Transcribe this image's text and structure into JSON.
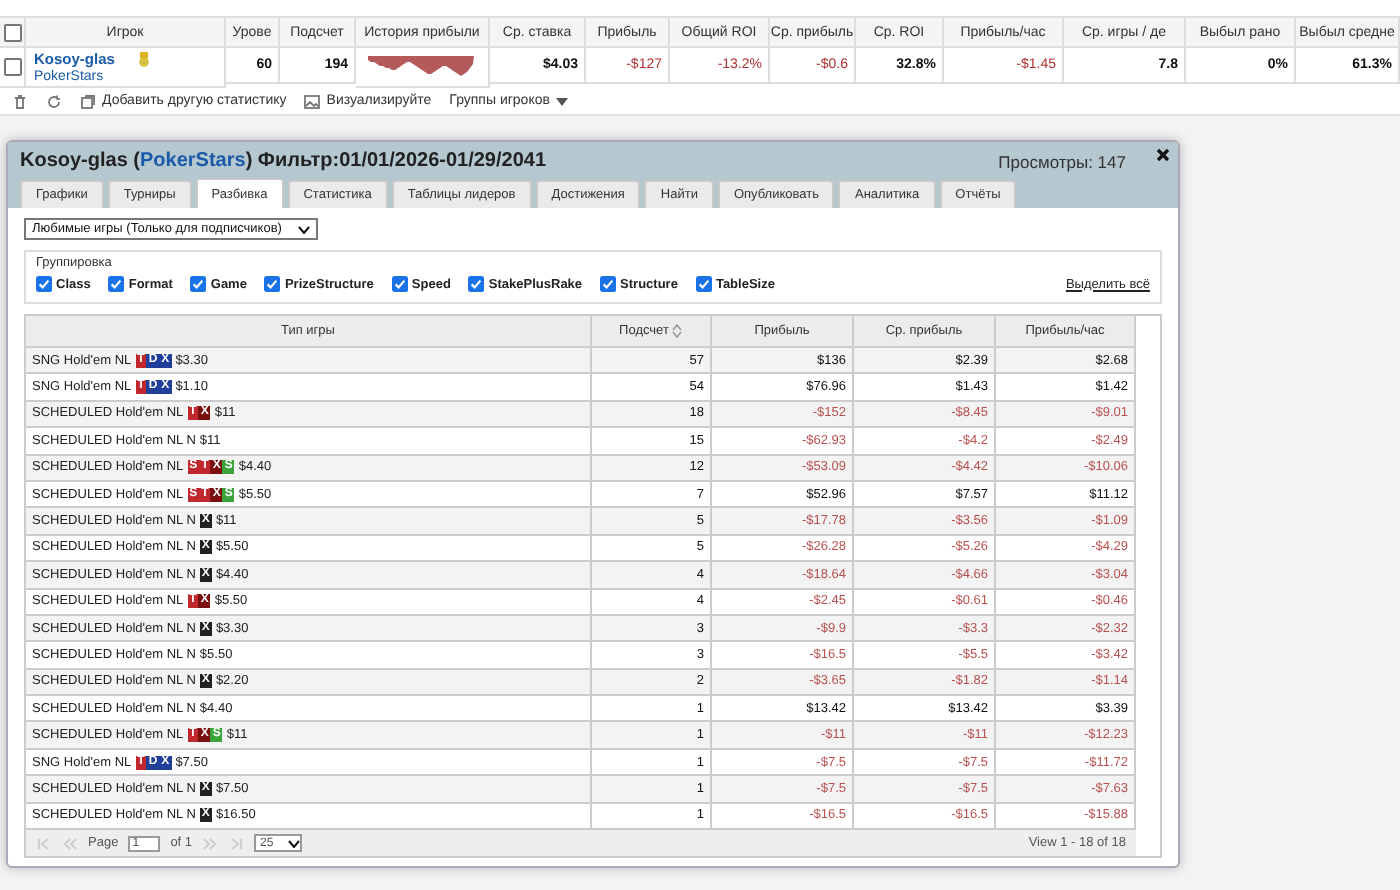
{
  "players_table": {
    "columns": [
      "Игрок",
      "Урове",
      "Подсчет",
      "История прибыли",
      "Ср. ставка",
      "Прибыль",
      "Общий ROI",
      "Ср. прибыль",
      "Ср. ROI",
      "Прибыль/час",
      "Ср. игры / де",
      "Выбыл рано",
      "Выбыл средне"
    ],
    "all_checked": false,
    "rows": [
      {
        "checked": false,
        "cells": [
          {
            "kind": "player",
            "player": "Kosoy-glas",
            "site": "PokerStars"
          },
          {
            "kind": "text",
            "text": "60",
            "negative": false
          },
          {
            "kind": "text",
            "text": "194",
            "negative": false
          },
          {
            "kind": "sparkline"
          },
          {
            "kind": "text",
            "text": "$4.03",
            "negative": false
          },
          {
            "kind": "text",
            "text": "-$127",
            "negative": true
          },
          {
            "kind": "text",
            "text": "-13.2%",
            "negative": true
          },
          {
            "kind": "text",
            "text": "-$0.6",
            "negative": true
          },
          {
            "kind": "text",
            "text": "32.8%",
            "negative": false
          },
          {
            "kind": "text",
            "text": "-$1.45",
            "negative": true
          },
          {
            "kind": "text",
            "text": "7.8",
            "negative": false
          },
          {
            "kind": "text",
            "text": "0%",
            "negative": false
          },
          {
            "kind": "text",
            "text": "61.3%",
            "negative": false
          }
        ]
      }
    ]
  },
  "toolbar": {
    "add_stat": "Добавить другую статистику",
    "visualize": "Визуализируйте",
    "groups": "Группы игроков"
  },
  "dialog": {
    "title_before": "Kosoy-glas (",
    "title_link": "PokerStars",
    "title_after": ") Фильтр:01/01/2026-01/29/2041",
    "views": "Просмотры: 147",
    "tabs": [
      {
        "label": "Графики",
        "selected": false
      },
      {
        "label": "Турниры",
        "selected": false
      },
      {
        "label": "Разбивка",
        "selected": true
      },
      {
        "label": "Статистика",
        "selected": false
      },
      {
        "label": "Таблицы лидеров",
        "selected": false
      },
      {
        "label": "Достижения",
        "selected": false
      },
      {
        "label": "Найти",
        "selected": false
      },
      {
        "label": "Опубликовать",
        "selected": false
      },
      {
        "label": "Аналитика",
        "selected": false
      },
      {
        "label": "Отчёты",
        "selected": false
      }
    ],
    "game_select": "Любимые игры (Только для подписчиков)",
    "grouping": {
      "legend": "Группировка",
      "select_all": "Выделить всё",
      "options": [
        {
          "label": "Class",
          "checked": true
        },
        {
          "label": "Format",
          "checked": true
        },
        {
          "label": "Game",
          "checked": true
        },
        {
          "label": "PrizeStructure",
          "checked": true
        },
        {
          "label": "Speed",
          "checked": true
        },
        {
          "label": "StakePlusRake",
          "checked": true
        },
        {
          "label": "Structure",
          "checked": true
        },
        {
          "label": "TableSize",
          "checked": true
        }
      ]
    },
    "grid": {
      "columns": [
        {
          "label": "Тип игры",
          "sorted": false
        },
        {
          "label": "Подсчет",
          "sorted": true
        },
        {
          "label": "Прибыль",
          "sorted": false
        },
        {
          "label": "Ср. прибыль",
          "sorted": false
        },
        {
          "label": "Прибыль/час",
          "sorted": false
        }
      ],
      "rows": [
        {
          "game": "SNG Hold'em NL",
          "badges": [
            {
              "text": "T",
              "color": "#c0282d"
            },
            {
              "text": "D",
              "color": "#1f3f9a"
            },
            {
              "text": "X",
              "color": "#1f3f9a"
            }
          ],
          "stake": "$3.30",
          "count": "57",
          "profit": "$136",
          "avg": "$2.39",
          "hourly": "$2.68",
          "loss": false
        },
        {
          "game": "SNG Hold'em NL",
          "badges": [
            {
              "text": "T",
              "color": "#c0282d"
            },
            {
              "text": "D",
              "color": "#1f3f9a"
            },
            {
              "text": "X",
              "color": "#1f3f9a"
            }
          ],
          "stake": "$1.10",
          "count": "54",
          "profit": "$76.96",
          "avg": "$1.43",
          "hourly": "$1.42",
          "loss": false
        },
        {
          "game": "SCHEDULED Hold'em NL",
          "badges": [
            {
              "text": "T",
              "color": "#c0282d"
            },
            {
              "text": "X",
              "color": "#7a1010"
            }
          ],
          "stake": "$11",
          "count": "18",
          "profit": "-$152",
          "avg": "-$8.45",
          "hourly": "-$9.01",
          "loss": true
        },
        {
          "game": "SCHEDULED Hold'em NL N",
          "badges": [],
          "stake": "$11",
          "count": "15",
          "profit": "-$62.93",
          "avg": "-$4.2",
          "hourly": "-$2.49",
          "loss": true
        },
        {
          "game": "SCHEDULED Hold'em NL",
          "badges": [
            {
              "text": "S",
              "color": "#c0282d"
            },
            {
              "text": "T",
              "color": "#c0282d"
            },
            {
              "text": "X",
              "color": "#7a1010"
            },
            {
              "text": "S",
              "color": "#3aa43a"
            }
          ],
          "stake": "$4.40",
          "count": "12",
          "profit": "-$53.09",
          "avg": "-$4.42",
          "hourly": "-$10.06",
          "loss": true
        },
        {
          "game": "SCHEDULED Hold'em NL",
          "badges": [
            {
              "text": "S",
              "color": "#c0282d"
            },
            {
              "text": "T",
              "color": "#c0282d"
            },
            {
              "text": "X",
              "color": "#7a1010"
            },
            {
              "text": "S",
              "color": "#3aa43a"
            }
          ],
          "stake": "$5.50",
          "count": "7",
          "profit": "$52.96",
          "avg": "$7.57",
          "hourly": "$11.12",
          "loss": false
        },
        {
          "game": "SCHEDULED Hold'em NL N",
          "badges": [
            {
              "text": "X",
              "color": "#222222"
            }
          ],
          "stake": "$11",
          "count": "5",
          "profit": "-$17.78",
          "avg": "-$3.56",
          "hourly": "-$1.09",
          "loss": true
        },
        {
          "game": "SCHEDULED Hold'em NL N",
          "badges": [
            {
              "text": "X",
              "color": "#222222"
            }
          ],
          "stake": "$5.50",
          "count": "5",
          "profit": "-$26.28",
          "avg": "-$5.26",
          "hourly": "-$4.29",
          "loss": true
        },
        {
          "game": "SCHEDULED Hold'em NL N",
          "badges": [
            {
              "text": "X",
              "color": "#222222"
            }
          ],
          "stake": "$4.40",
          "count": "4",
          "profit": "-$18.64",
          "avg": "-$4.66",
          "hourly": "-$3.04",
          "loss": true
        },
        {
          "game": "SCHEDULED Hold'em NL",
          "badges": [
            {
              "text": "T",
              "color": "#c0282d"
            },
            {
              "text": "X",
              "color": "#7a1010"
            }
          ],
          "stake": "$5.50",
          "count": "4",
          "profit": "-$2.45",
          "avg": "-$0.61",
          "hourly": "-$0.46",
          "loss": true
        },
        {
          "game": "SCHEDULED Hold'em NL N",
          "badges": [
            {
              "text": "X",
              "color": "#222222"
            }
          ],
          "stake": "$3.30",
          "count": "3",
          "profit": "-$9.9",
          "avg": "-$3.3",
          "hourly": "-$2.32",
          "loss": true
        },
        {
          "game": "SCHEDULED Hold'em NL N",
          "badges": [],
          "stake": "$5.50",
          "count": "3",
          "profit": "-$16.5",
          "avg": "-$5.5",
          "hourly": "-$3.42",
          "loss": true
        },
        {
          "game": "SCHEDULED Hold'em NL N",
          "badges": [
            {
              "text": "X",
              "color": "#222222"
            }
          ],
          "stake": "$2.20",
          "count": "2",
          "profit": "-$3.65",
          "avg": "-$1.82",
          "hourly": "-$1.14",
          "loss": true
        },
        {
          "game": "SCHEDULED Hold'em NL N",
          "badges": [],
          "stake": "$4.40",
          "count": "1",
          "profit": "$13.42",
          "avg": "$13.42",
          "hourly": "$3.39",
          "loss": false
        },
        {
          "game": "SCHEDULED Hold'em NL",
          "badges": [
            {
              "text": "T",
              "color": "#c0282d"
            },
            {
              "text": "X",
              "color": "#7a1010"
            },
            {
              "text": "S",
              "color": "#3aa43a"
            }
          ],
          "stake": "$11",
          "count": "1",
          "profit": "-$11",
          "avg": "-$11",
          "hourly": "-$12.23",
          "loss": true
        },
        {
          "game": "SNG Hold'em NL",
          "badges": [
            {
              "text": "T",
              "color": "#c0282d"
            },
            {
              "text": "D",
              "color": "#1f3f9a"
            },
            {
              "text": "X",
              "color": "#1f3f9a"
            }
          ],
          "stake": "$7.50",
          "count": "1",
          "profit": "-$7.5",
          "avg": "-$7.5",
          "hourly": "-$11.72",
          "loss": true
        },
        {
          "game": "SCHEDULED Hold'em NL N",
          "badges": [
            {
              "text": "X",
              "color": "#222222"
            }
          ],
          "stake": "$7.50",
          "count": "1",
          "profit": "-$7.5",
          "avg": "-$7.5",
          "hourly": "-$7.63",
          "loss": true
        },
        {
          "game": "SCHEDULED Hold'em NL N",
          "badges": [
            {
              "text": "X",
              "color": "#222222"
            }
          ],
          "stake": "$16.50",
          "count": "1",
          "profit": "-$16.5",
          "avg": "-$16.5",
          "hourly": "-$15.88",
          "loss": true
        }
      ]
    },
    "pager": {
      "page_label": "Page",
      "page": "1",
      "of": "of 1",
      "page_size": "25",
      "view": "View 1 - 18 of 18"
    }
  }
}
